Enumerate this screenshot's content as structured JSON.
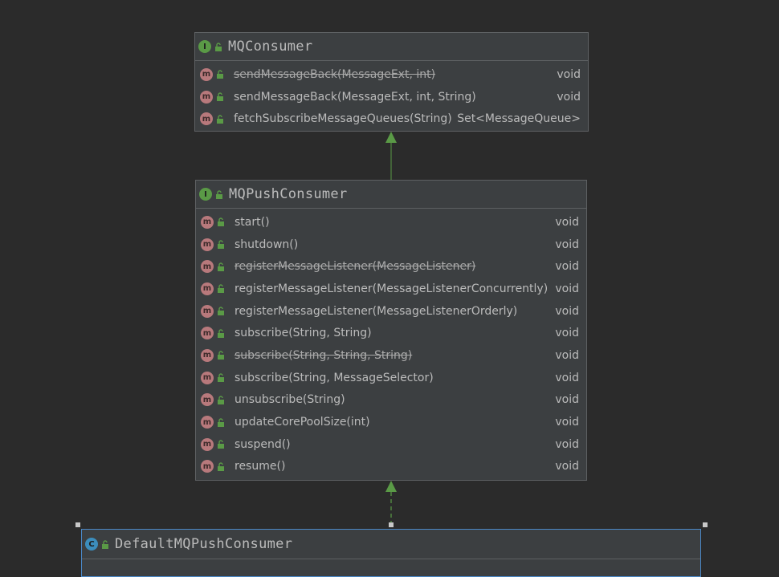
{
  "diagram": {
    "mqconsumer": {
      "kind_badge": "I",
      "name": "MQConsumer",
      "methods": [
        {
          "badge": "m",
          "signature": "sendMessageBack(MessageExt, int)",
          "return": "void",
          "deprecated": true
        },
        {
          "badge": "m",
          "signature": "sendMessageBack(MessageExt, int, String)",
          "return": "void",
          "deprecated": false
        },
        {
          "badge": "m",
          "signature": "fetchSubscribeMessageQueues(String)",
          "return": "Set<MessageQueue>",
          "deprecated": false
        }
      ]
    },
    "mqpushconsumer": {
      "kind_badge": "I",
      "name": "MQPushConsumer",
      "methods": [
        {
          "badge": "m",
          "signature": "start()",
          "return": "void",
          "deprecated": false
        },
        {
          "badge": "m",
          "signature": "shutdown()",
          "return": "void",
          "deprecated": false
        },
        {
          "badge": "m",
          "signature": "registerMessageListener(MessageListener)",
          "return": "void",
          "deprecated": true
        },
        {
          "badge": "m",
          "signature": "registerMessageListener(MessageListenerConcurrently)",
          "return": "void",
          "deprecated": false
        },
        {
          "badge": "m",
          "signature": "registerMessageListener(MessageListenerOrderly)",
          "return": "void",
          "deprecated": false
        },
        {
          "badge": "m",
          "signature": "subscribe(String, String)",
          "return": "void",
          "deprecated": false
        },
        {
          "badge": "m",
          "signature": "subscribe(String, String, String)",
          "return": "void",
          "deprecated": true
        },
        {
          "badge": "m",
          "signature": "subscribe(String, MessageSelector)",
          "return": "void",
          "deprecated": false
        },
        {
          "badge": "m",
          "signature": "unsubscribe(String)",
          "return": "void",
          "deprecated": false
        },
        {
          "badge": "m",
          "signature": "updateCorePoolSize(int)",
          "return": "void",
          "deprecated": false
        },
        {
          "badge": "m",
          "signature": "suspend()",
          "return": "void",
          "deprecated": false
        },
        {
          "badge": "m",
          "signature": "resume()",
          "return": "void",
          "deprecated": false
        }
      ]
    },
    "defaultmqpushconsumer": {
      "kind_badge": "C",
      "name": "DefaultMQPushConsumer"
    },
    "colors": {
      "background": "#2b2b2b",
      "box": "#3c3f41",
      "interface_badge": "#5a9a46",
      "class_badge": "#3c8dbc",
      "method_badge": "#b8797c",
      "arrow": "#5a9a46",
      "selection": "#4a88c7"
    },
    "icons": {
      "interface": "interface-icon",
      "class": "class-icon",
      "method": "method-icon",
      "visibility": "public-lock-icon"
    }
  }
}
